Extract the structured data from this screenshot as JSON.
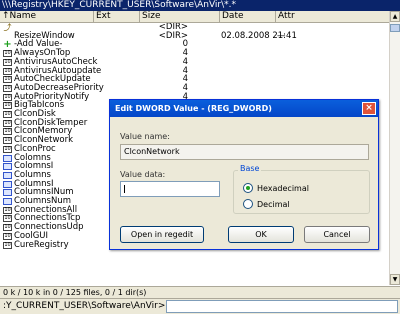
{
  "path_bar": {
    "text": "\\\\\\Registry\\HKEY_CURRENT_USER\\Software\\AnVir\\*.*"
  },
  "columns": {
    "name": "↑Name",
    "ext": "Ext",
    "size": "Size",
    "date": "Date",
    "attr": "Attr"
  },
  "rows": [
    {
      "icon": "up-dir-icon",
      "name": "",
      "size": "<DIR>",
      "date": "",
      "attr": ""
    },
    {
      "icon": "folder-icon",
      "name": "ResizeWindow",
      "size": "<DIR>",
      "date": "02.08.2008 21:41",
      "attr": "—"
    },
    {
      "icon": "add-value-icon",
      "name": "-Add Value-",
      "size": "0",
      "date": "",
      "attr": ""
    },
    {
      "icon": "dword-icon",
      "name": "AlwaysOnTop",
      "size": "4",
      "date": "",
      "attr": ""
    },
    {
      "icon": "dword-icon",
      "name": "AntivirusAutoCheck",
      "size": "4",
      "date": "",
      "attr": ""
    },
    {
      "icon": "dword-icon",
      "name": "AntivirusAutoupdate",
      "size": "4",
      "date": "",
      "attr": ""
    },
    {
      "icon": "dword-icon",
      "name": "AutoCheckUpdate",
      "size": "4",
      "date": "",
      "attr": ""
    },
    {
      "icon": "dword-icon",
      "name": "AutoDecreasePriority",
      "size": "4",
      "date": "",
      "attr": ""
    },
    {
      "icon": "dword-icon",
      "name": "AutoPriorityNotify",
      "size": "4",
      "date": "",
      "attr": ""
    },
    {
      "icon": "dword-icon",
      "name": "BigTabIcons",
      "size": "4",
      "date": "",
      "attr": ""
    },
    {
      "icon": "dword-icon",
      "name": "ClconDisk",
      "size": "4",
      "date": "",
      "attr": ""
    },
    {
      "icon": "dword-icon",
      "name": "ClconDiskTemper",
      "size": "4",
      "date": "",
      "attr": ""
    },
    {
      "icon": "dword-icon",
      "name": "ClconMemory",
      "size": "4",
      "date": "",
      "attr": ""
    },
    {
      "icon": "dword-icon",
      "name": "ClconNetwork",
      "size": "4",
      "date": "",
      "attr": ""
    },
    {
      "icon": "dword-icon",
      "name": "ClconProc",
      "size": "4",
      "date": "",
      "attr": ""
    },
    {
      "icon": "binary-icon",
      "name": "Colomns",
      "size": "4",
      "date": "",
      "attr": ""
    },
    {
      "icon": "binary-icon",
      "name": "ColomnsI",
      "size": "4",
      "date": "",
      "attr": ""
    },
    {
      "icon": "binary-icon",
      "name": "Columns",
      "size": "4",
      "date": "",
      "attr": ""
    },
    {
      "icon": "binary-icon",
      "name": "ColumnsI",
      "size": "4",
      "date": "",
      "attr": ""
    },
    {
      "icon": "binary-icon",
      "name": "ColumnsINum",
      "size": "4",
      "date": "",
      "attr": ""
    },
    {
      "icon": "binary-icon",
      "name": "ColumnsNum",
      "size": "4",
      "date": "",
      "attr": ""
    },
    {
      "icon": "dword-icon",
      "name": "ConnectionsAll",
      "size": "4",
      "date": "",
      "attr": ""
    },
    {
      "icon": "dword-icon",
      "name": "ConnectionsTcp",
      "size": "4",
      "date": "",
      "attr": ""
    },
    {
      "icon": "dword-icon",
      "name": "ConnectionsUdp",
      "size": "4",
      "date": "",
      "attr": ""
    },
    {
      "icon": "dword-icon",
      "name": "CoolGUI",
      "size": "4",
      "date": "",
      "attr": ""
    },
    {
      "icon": "dword-icon",
      "name": "CureRegistry",
      "size": "4",
      "date": "",
      "attr": ""
    }
  ],
  "status": {
    "text": "0 k / 10 k in 0 / 125 files, 0 / 1 dir(s)"
  },
  "command_line": {
    "path": ":Y_CURRENT_USER\\Software\\AnVir>",
    "value": ""
  },
  "dialog": {
    "title": "Edit DWORD Value - (REG_DWORD)",
    "close_glyph": "×",
    "value_name_label": "Value name:",
    "value_name": "ClconNetwork",
    "value_data_label": "Value data:",
    "value_data": "",
    "base_label": "Base",
    "hex_label": "Hexadecimal",
    "dec_label": "Decimal",
    "selected_base": "hexadecimal",
    "open_regedit_label": "Open in regedit",
    "ok_label": "OK",
    "cancel_label": "Cancel"
  }
}
